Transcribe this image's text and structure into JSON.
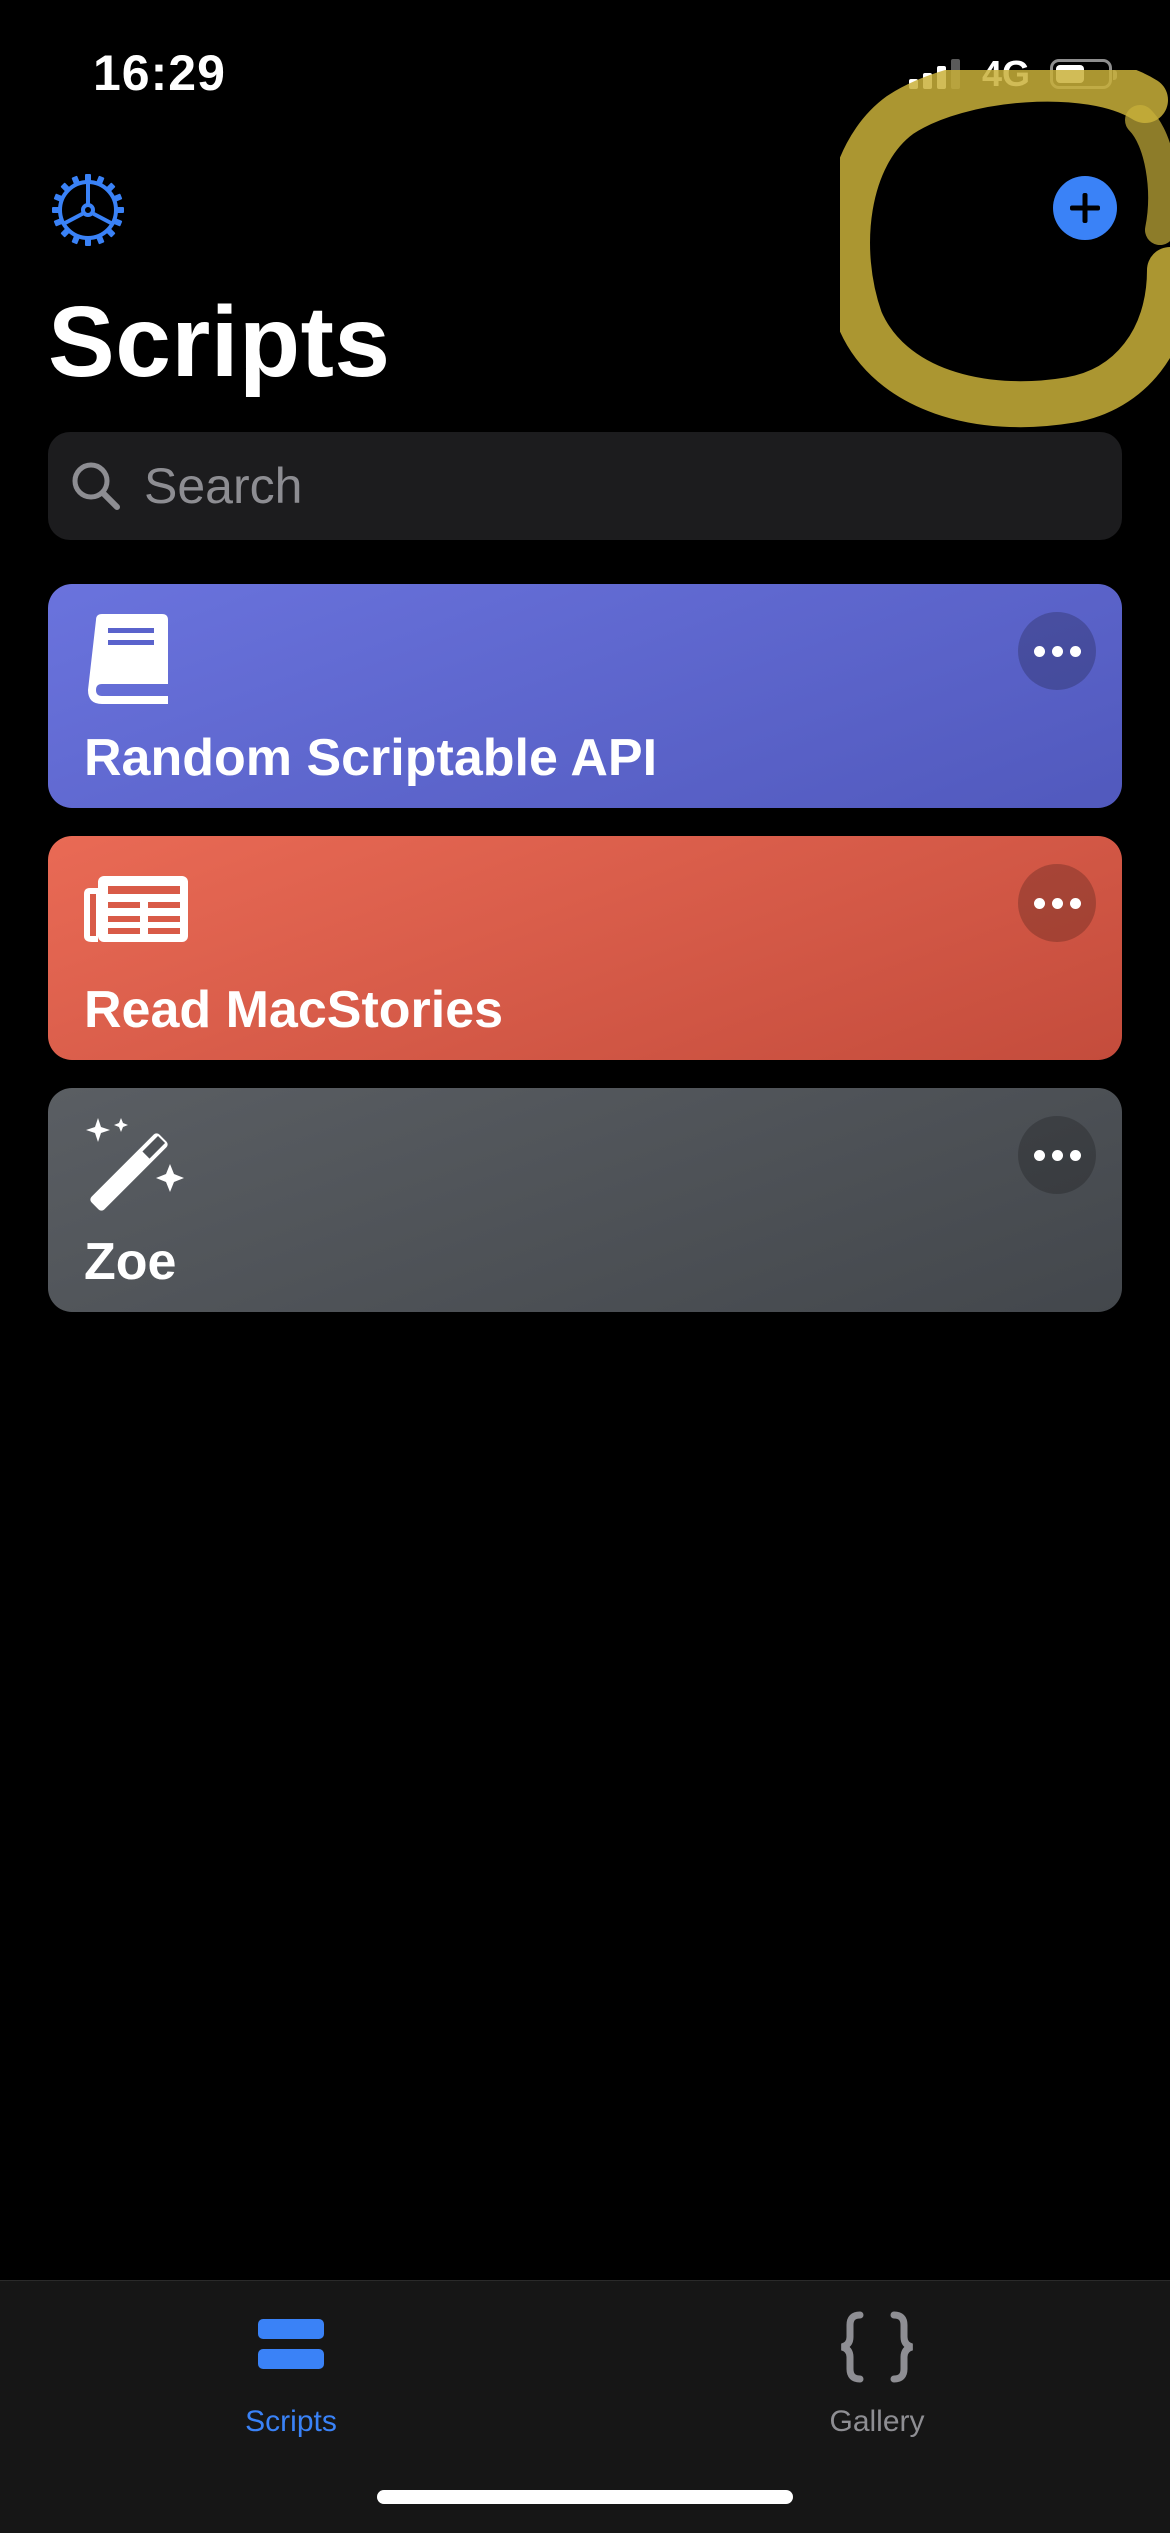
{
  "status_bar": {
    "time": "16:29",
    "network": "4G",
    "battery_level": 0.55
  },
  "header": {
    "title": "Scripts",
    "settings_icon": "gear-icon",
    "add_icon": "plus-icon",
    "accent_color": "#3a82f7",
    "highlight_color": "#c9b03a"
  },
  "search": {
    "placeholder": "Search",
    "value": ""
  },
  "scripts": [
    {
      "title": "Random Scriptable API",
      "icon": "book-icon",
      "color": "#5a63cc"
    },
    {
      "title": "Read MacStories",
      "icon": "newspaper-icon",
      "color": "#d95b48"
    },
    {
      "title": "Zoe",
      "icon": "magic-wand-icon",
      "color": "#4f5358"
    }
  ],
  "tab_bar": {
    "tabs": [
      {
        "label": "Scripts",
        "icon": "scripts-icon",
        "selected": true
      },
      {
        "label": "Gallery",
        "icon": "braces-icon",
        "selected": false
      }
    ]
  }
}
